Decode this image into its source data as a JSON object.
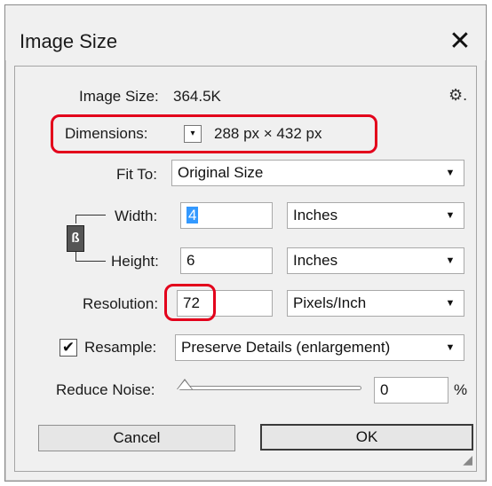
{
  "window": {
    "title": "Image Size",
    "close_label": "✕"
  },
  "image_size": {
    "label": "Image Size:",
    "value": "364.5K",
    "gear_icon": "gear-icon"
  },
  "dimensions": {
    "label": "Dimensions:",
    "value": "288 px  ×  432 px"
  },
  "fit_to": {
    "label": "Fit To:",
    "value": "Original Size"
  },
  "width": {
    "label": "Width:",
    "value": "4",
    "unit": "Inches"
  },
  "height": {
    "label": "Height:",
    "value": "6",
    "unit": "Inches"
  },
  "resolution": {
    "label": "Resolution:",
    "value": "72",
    "unit": "Pixels/Inch"
  },
  "resample": {
    "checked": true,
    "label": "Resample:",
    "value": "Preserve Details (enlargement)"
  },
  "reduce_noise": {
    "label": "Reduce Noise:",
    "value": "0",
    "unit": "%",
    "level": 0
  },
  "buttons": {
    "cancel": "Cancel",
    "ok": "OK"
  },
  "annotations": {
    "highlight_color": "#e3001b"
  }
}
